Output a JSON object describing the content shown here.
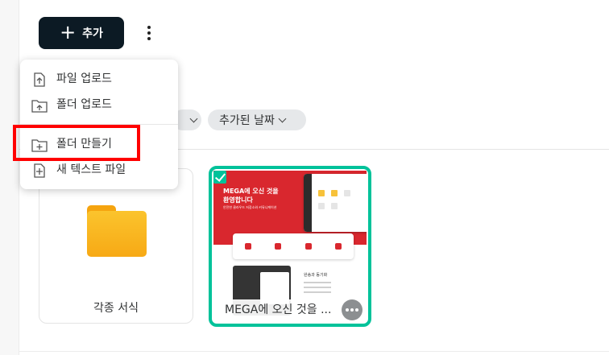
{
  "toolbar": {
    "add_label": "추가",
    "add_icon": "plus-icon",
    "more_icon": "kebab-vertical-icon"
  },
  "filters": {
    "date_added_label": "추가된 날짜"
  },
  "items": [
    {
      "name": "각종 서식",
      "type": "folder",
      "icon": "folder-icon"
    },
    {
      "name": "MEGA에 오신 것을 ...",
      "type": "file",
      "selected": true,
      "thumbnail": {
        "title_line1": "MEGA에 오신 것을",
        "title_line2": "환영합니다",
        "subtitle": "안전한 클라우드 저장소와 커뮤니케이션",
        "feature_heading": "완송과 동기화"
      }
    }
  ],
  "add_menu": {
    "items": [
      {
        "label": "파일 업로드",
        "icon": "file-upload-icon"
      },
      {
        "label": "폴더 업로드",
        "icon": "folder-upload-icon"
      },
      {
        "label": "폴더 만들기",
        "icon": "create-folder-icon",
        "highlighted": true
      },
      {
        "label": "새 텍스트 파일",
        "icon": "new-text-file-icon"
      }
    ]
  },
  "colors": {
    "primary_button": "#0c1a24",
    "selection_accent": "#00c29a",
    "highlight_box": "#ff0000",
    "folder": "#f7a915"
  }
}
